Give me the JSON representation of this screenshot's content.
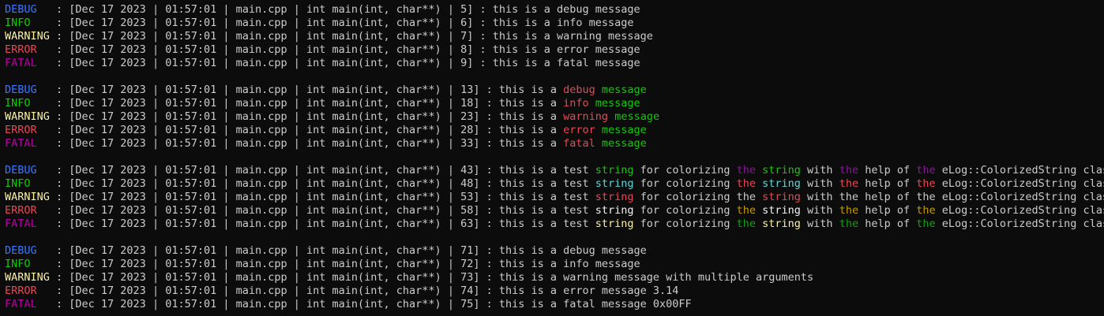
{
  "window": {
    "title": ""
  },
  "colors": {
    "background": "#0c0c0c",
    "default": "#cccccc",
    "debug": "#3b78ff",
    "info": "#16c60c",
    "warning": "#f9f1a5",
    "error": "#e74856",
    "fatal": "#b4009e",
    "green": "#16c60c",
    "red": "#e74856",
    "purple": "#881798",
    "cyan": "#61d6d6",
    "yellow": "#c19c00",
    "white": "#f2f2f2",
    "dark_green": "#13a10e"
  },
  "lines": [
    {
      "level": "DEBUG",
      "prefix": "   : [Dec 17 2023 | 01:57:01 | main.cpp | int main(int, char**) | 5] : ",
      "segments": [
        [
          "this is a debug message",
          "default"
        ]
      ]
    },
    {
      "level": "INFO",
      "prefix": "    : [Dec 17 2023 | 01:57:01 | main.cpp | int main(int, char**) | 6] : ",
      "segments": [
        [
          "this is a info message",
          "default"
        ]
      ]
    },
    {
      "level": "WARNING",
      "prefix": " : [Dec 17 2023 | 01:57:01 | main.cpp | int main(int, char**) | 7] : ",
      "segments": [
        [
          "this is a warning message",
          "default"
        ]
      ]
    },
    {
      "level": "ERROR",
      "prefix": "   : [Dec 17 2023 | 01:57:01 | main.cpp | int main(int, char**) | 8] : ",
      "segments": [
        [
          "this is a error message",
          "default"
        ]
      ]
    },
    {
      "level": "FATAL",
      "prefix": "   : [Dec 17 2023 | 01:57:01 | main.cpp | int main(int, char**) | 9] : ",
      "segments": [
        [
          "this is a fatal message",
          "default"
        ]
      ]
    },
    {
      "blank": true
    },
    {
      "level": "DEBUG",
      "prefix": "   : [Dec 17 2023 | 01:57:01 | main.cpp | int main(int, char**) | 13] : ",
      "segments": [
        [
          "this is a ",
          "default"
        ],
        [
          "debug",
          "red"
        ],
        [
          " ",
          "default"
        ],
        [
          "message",
          "green"
        ]
      ]
    },
    {
      "level": "INFO",
      "prefix": "    : [Dec 17 2023 | 01:57:01 | main.cpp | int main(int, char**) | 18] : ",
      "segments": [
        [
          "this is a ",
          "default"
        ],
        [
          "info",
          "red"
        ],
        [
          " ",
          "default"
        ],
        [
          "message",
          "green"
        ]
      ]
    },
    {
      "level": "WARNING",
      "prefix": " : [Dec 17 2023 | 01:57:01 | main.cpp | int main(int, char**) | 23] : ",
      "segments": [
        [
          "this is a ",
          "default"
        ],
        [
          "warning",
          "red"
        ],
        [
          " ",
          "default"
        ],
        [
          "message",
          "green"
        ]
      ]
    },
    {
      "level": "ERROR",
      "prefix": "   : [Dec 17 2023 | 01:57:01 | main.cpp | int main(int, char**) | 28] : ",
      "segments": [
        [
          "this is a ",
          "default"
        ],
        [
          "error",
          "red"
        ],
        [
          " ",
          "default"
        ],
        [
          "message",
          "green"
        ]
      ]
    },
    {
      "level": "FATAL",
      "prefix": "   : [Dec 17 2023 | 01:57:01 | main.cpp | int main(int, char**) | 33] : ",
      "segments": [
        [
          "this is a ",
          "default"
        ],
        [
          "fatal",
          "red"
        ],
        [
          " ",
          "default"
        ],
        [
          "message",
          "green"
        ]
      ]
    },
    {
      "blank": true
    },
    {
      "level": "DEBUG",
      "prefix": "   : [Dec 17 2023 | 01:57:01 | main.cpp | int main(int, char**) | 43] : ",
      "segments": [
        [
          "this is a test ",
          "default"
        ],
        [
          "string",
          "green"
        ],
        [
          " for colorizing ",
          "default"
        ],
        [
          "the",
          "purple"
        ],
        [
          " ",
          "default"
        ],
        [
          "string",
          "green"
        ],
        [
          " with ",
          "default"
        ],
        [
          "the",
          "purple"
        ],
        [
          " help of ",
          "default"
        ],
        [
          "the",
          "purple"
        ],
        [
          " eLog::ColorizedString class",
          "default"
        ]
      ]
    },
    {
      "level": "INFO",
      "prefix": "    : [Dec 17 2023 | 01:57:01 | main.cpp | int main(int, char**) | 48] : ",
      "segments": [
        [
          "this is a test ",
          "default"
        ],
        [
          "string",
          "cyan"
        ],
        [
          " for colorizing ",
          "default"
        ],
        [
          "the",
          "red"
        ],
        [
          " ",
          "default"
        ],
        [
          "string",
          "cyan"
        ],
        [
          " with ",
          "default"
        ],
        [
          "the",
          "red"
        ],
        [
          " help of ",
          "default"
        ],
        [
          "the",
          "red"
        ],
        [
          " eLog::ColorizedString class",
          "default"
        ]
      ]
    },
    {
      "level": "WARNING",
      "prefix": " : [Dec 17 2023 | 01:57:01 | main.cpp | int main(int, char**) | 53] : ",
      "segments": [
        [
          "this is a test ",
          "default"
        ],
        [
          "string",
          "red"
        ],
        [
          " for colorizing the ",
          "default"
        ],
        [
          "string",
          "red"
        ],
        [
          " with the help of the eLog::ColorizedString class",
          "default"
        ]
      ]
    },
    {
      "level": "ERROR",
      "prefix": "   : [Dec 17 2023 | 01:57:01 | main.cpp | int main(int, char**) | 58] : ",
      "segments": [
        [
          "this is a test ",
          "default"
        ],
        [
          "string",
          "white"
        ],
        [
          " for colorizing ",
          "default"
        ],
        [
          "the",
          "yellow"
        ],
        [
          " ",
          "default"
        ],
        [
          "string",
          "white"
        ],
        [
          " with ",
          "default"
        ],
        [
          "the",
          "yellow"
        ],
        [
          " help of ",
          "default"
        ],
        [
          "the",
          "yellow"
        ],
        [
          " eLog::ColorizedString class",
          "default"
        ]
      ]
    },
    {
      "level": "FATAL",
      "prefix": "   : [Dec 17 2023 | 01:57:01 | main.cpp | int main(int, char**) | 63] : ",
      "segments": [
        [
          "this is a test ",
          "default"
        ],
        [
          "string",
          "lyellow"
        ],
        [
          " for colorizing ",
          "default"
        ],
        [
          "the",
          "dgreen"
        ],
        [
          " ",
          "default"
        ],
        [
          "string",
          "lyellow"
        ],
        [
          " with ",
          "default"
        ],
        [
          "the",
          "dgreen"
        ],
        [
          " help of ",
          "default"
        ],
        [
          "the",
          "dgreen"
        ],
        [
          " eLog::ColorizedString class",
          "default"
        ]
      ]
    },
    {
      "blank": true
    },
    {
      "level": "DEBUG",
      "prefix": "   : [Dec 17 2023 | 01:57:01 | main.cpp | int main(int, char**) | 71] : ",
      "segments": [
        [
          "this is a debug message",
          "default"
        ]
      ]
    },
    {
      "level": "INFO",
      "prefix": "    : [Dec 17 2023 | 01:57:01 | main.cpp | int main(int, char**) | 72] : ",
      "segments": [
        [
          "this is a info message",
          "default"
        ]
      ]
    },
    {
      "level": "WARNING",
      "prefix": " : [Dec 17 2023 | 01:57:01 | main.cpp | int main(int, char**) | 73] : ",
      "segments": [
        [
          "this is a warning message with multiple arguments",
          "default"
        ]
      ]
    },
    {
      "level": "ERROR",
      "prefix": "   : [Dec 17 2023 | 01:57:01 | main.cpp | int main(int, char**) | 74] : ",
      "segments": [
        [
          "this is a error message 3.14",
          "default"
        ]
      ]
    },
    {
      "level": "FATAL",
      "prefix": "   : [Dec 17 2023 | 01:57:01 | main.cpp | int main(int, char**) | 75] : ",
      "segments": [
        [
          "this is a fatal message 0x00FF",
          "default"
        ]
      ]
    }
  ]
}
